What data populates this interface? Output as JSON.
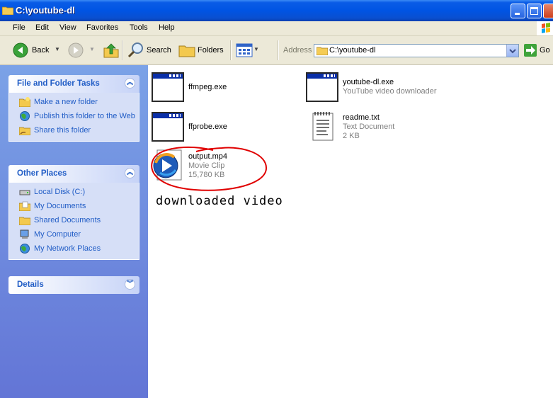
{
  "window": {
    "title": "C:\\youtube-dl"
  },
  "menu": [
    "File",
    "Edit",
    "View",
    "Favorites",
    "Tools",
    "Help"
  ],
  "toolbar": {
    "back_label": "Back",
    "search_label": "Search",
    "folders_label": "Folders",
    "address_label": "Address",
    "address_value": "C:\\youtube-dl",
    "go_label": "Go"
  },
  "left_pane": {
    "file_tasks": {
      "title": "File and Folder Tasks",
      "items": [
        "Make a new folder",
        "Publish this folder to the Web",
        "Share this folder"
      ]
    },
    "other_places": {
      "title": "Other Places",
      "items": [
        "Local Disk (C:)",
        "My Documents",
        "Shared Documents",
        "My Computer",
        "My Network Places"
      ]
    },
    "details": {
      "title": "Details"
    }
  },
  "files": [
    {
      "name": "ffmpeg.exe",
      "desc": "",
      "size": "",
      "icon": "application-window-icon"
    },
    {
      "name": "youtube-dl.exe",
      "desc": "YouTube video downloader",
      "size": "",
      "icon": "application-window-icon"
    },
    {
      "name": "ffprobe.exe",
      "desc": "",
      "size": "",
      "icon": "application-window-icon"
    },
    {
      "name": "readme.txt",
      "desc": "Text Document",
      "size": "2 KB",
      "icon": "text-document-icon"
    },
    {
      "name": "output.mp4",
      "desc": "Movie Clip",
      "size": "15,780 KB",
      "icon": "media-player-icon"
    }
  ],
  "annotation": {
    "text": "downloaded video",
    "circle_color": "#e00000"
  },
  "colors": {
    "titlebar": "#0054e3",
    "link": "#215dc6",
    "pane": "#6d8ee0"
  }
}
